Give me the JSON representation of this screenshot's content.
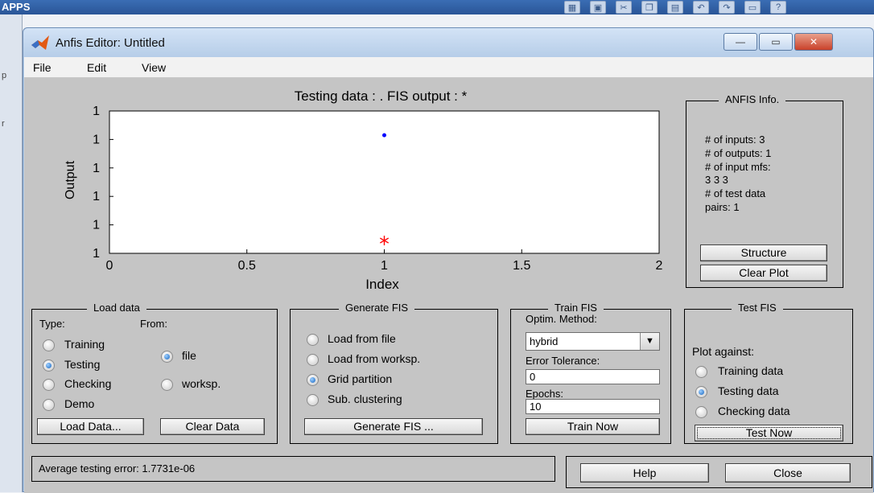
{
  "background": {
    "app_label": "APPS",
    "toolbar_icons": [
      "chart-icon",
      "save-icon",
      "cut-icon",
      "copy-icon",
      "paste-icon",
      "undo-icon",
      "redo-icon",
      "switch-window-icon",
      "help-icon"
    ],
    "help_glyph": "?"
  },
  "window": {
    "title": "Anfis Editor: Untitled",
    "controls": {
      "minimize": "—",
      "maximize": "▭",
      "close": "✕"
    }
  },
  "menu": [
    "File",
    "Edit",
    "View"
  ],
  "plot": {
    "title": "Testing data : .   FIS output : *",
    "xlabel": "Index",
    "ylabel": "Output"
  },
  "chart_data": {
    "type": "scatter",
    "title": "Testing data : .   FIS output : *",
    "xlabel": "Index",
    "ylabel": "Output",
    "xlim": [
      0,
      2
    ],
    "x_ticks": [
      "0",
      "0.5",
      "1",
      "1.5",
      "2"
    ],
    "y_ticks": [
      "1",
      "1",
      "1",
      "1",
      "1",
      "1"
    ],
    "grid": false,
    "series": [
      {
        "name": "Testing data",
        "marker": ".",
        "color": "#0000ff",
        "x": [
          1
        ],
        "y_frac": [
          0.83
        ]
      },
      {
        "name": "FIS output",
        "marker": "*",
        "color": "#ff0000",
        "x": [
          1
        ],
        "y_frac": [
          0.09
        ]
      }
    ]
  },
  "anfis_info": {
    "title": "ANFIS Info.",
    "lines": [
      "# of inputs: 3",
      "# of outputs: 1",
      "# of input mfs:",
      "3  3  3",
      "# of test data",
      "pairs: 1"
    ],
    "structure_button": "Structure",
    "clear_plot_button": "Clear Plot"
  },
  "load_data": {
    "title": "Load data",
    "type_label": "Type:",
    "from_label": "From:",
    "types": [
      {
        "label": "Training",
        "checked": false
      },
      {
        "label": "Testing",
        "checked": true
      },
      {
        "label": "Checking",
        "checked": false
      },
      {
        "label": "Demo",
        "checked": false
      }
    ],
    "from": [
      {
        "label": "file",
        "checked": true
      },
      {
        "label": "worksp.",
        "checked": false
      }
    ],
    "load_button": "Load Data...",
    "clear_button": "Clear Data"
  },
  "generate_fis": {
    "title": "Generate FIS",
    "options": [
      {
        "label": "Load from file",
        "checked": false
      },
      {
        "label": "Load from worksp.",
        "checked": false
      },
      {
        "label": "Grid partition",
        "checked": true
      },
      {
        "label": "Sub. clustering",
        "checked": false
      }
    ],
    "button": "Generate FIS ..."
  },
  "train_fis": {
    "title": "Train FIS",
    "optim_label": "Optim. Method:",
    "optim_value": "hybrid",
    "error_label": "Error Tolerance:",
    "error_value": "0",
    "epochs_label": "Epochs:",
    "epochs_value": "10",
    "button": "Train Now"
  },
  "test_fis": {
    "title": "Test FIS",
    "plot_against_label": "Plot against:",
    "options": [
      {
        "label": "Training data",
        "checked": false
      },
      {
        "label": "Testing data",
        "checked": true
      },
      {
        "label": "Checking data",
        "checked": false
      }
    ],
    "button": "Test Now"
  },
  "status": {
    "text": "Average testing error: 1.7731e-06"
  },
  "footer": {
    "help": "Help",
    "close": "Close"
  }
}
